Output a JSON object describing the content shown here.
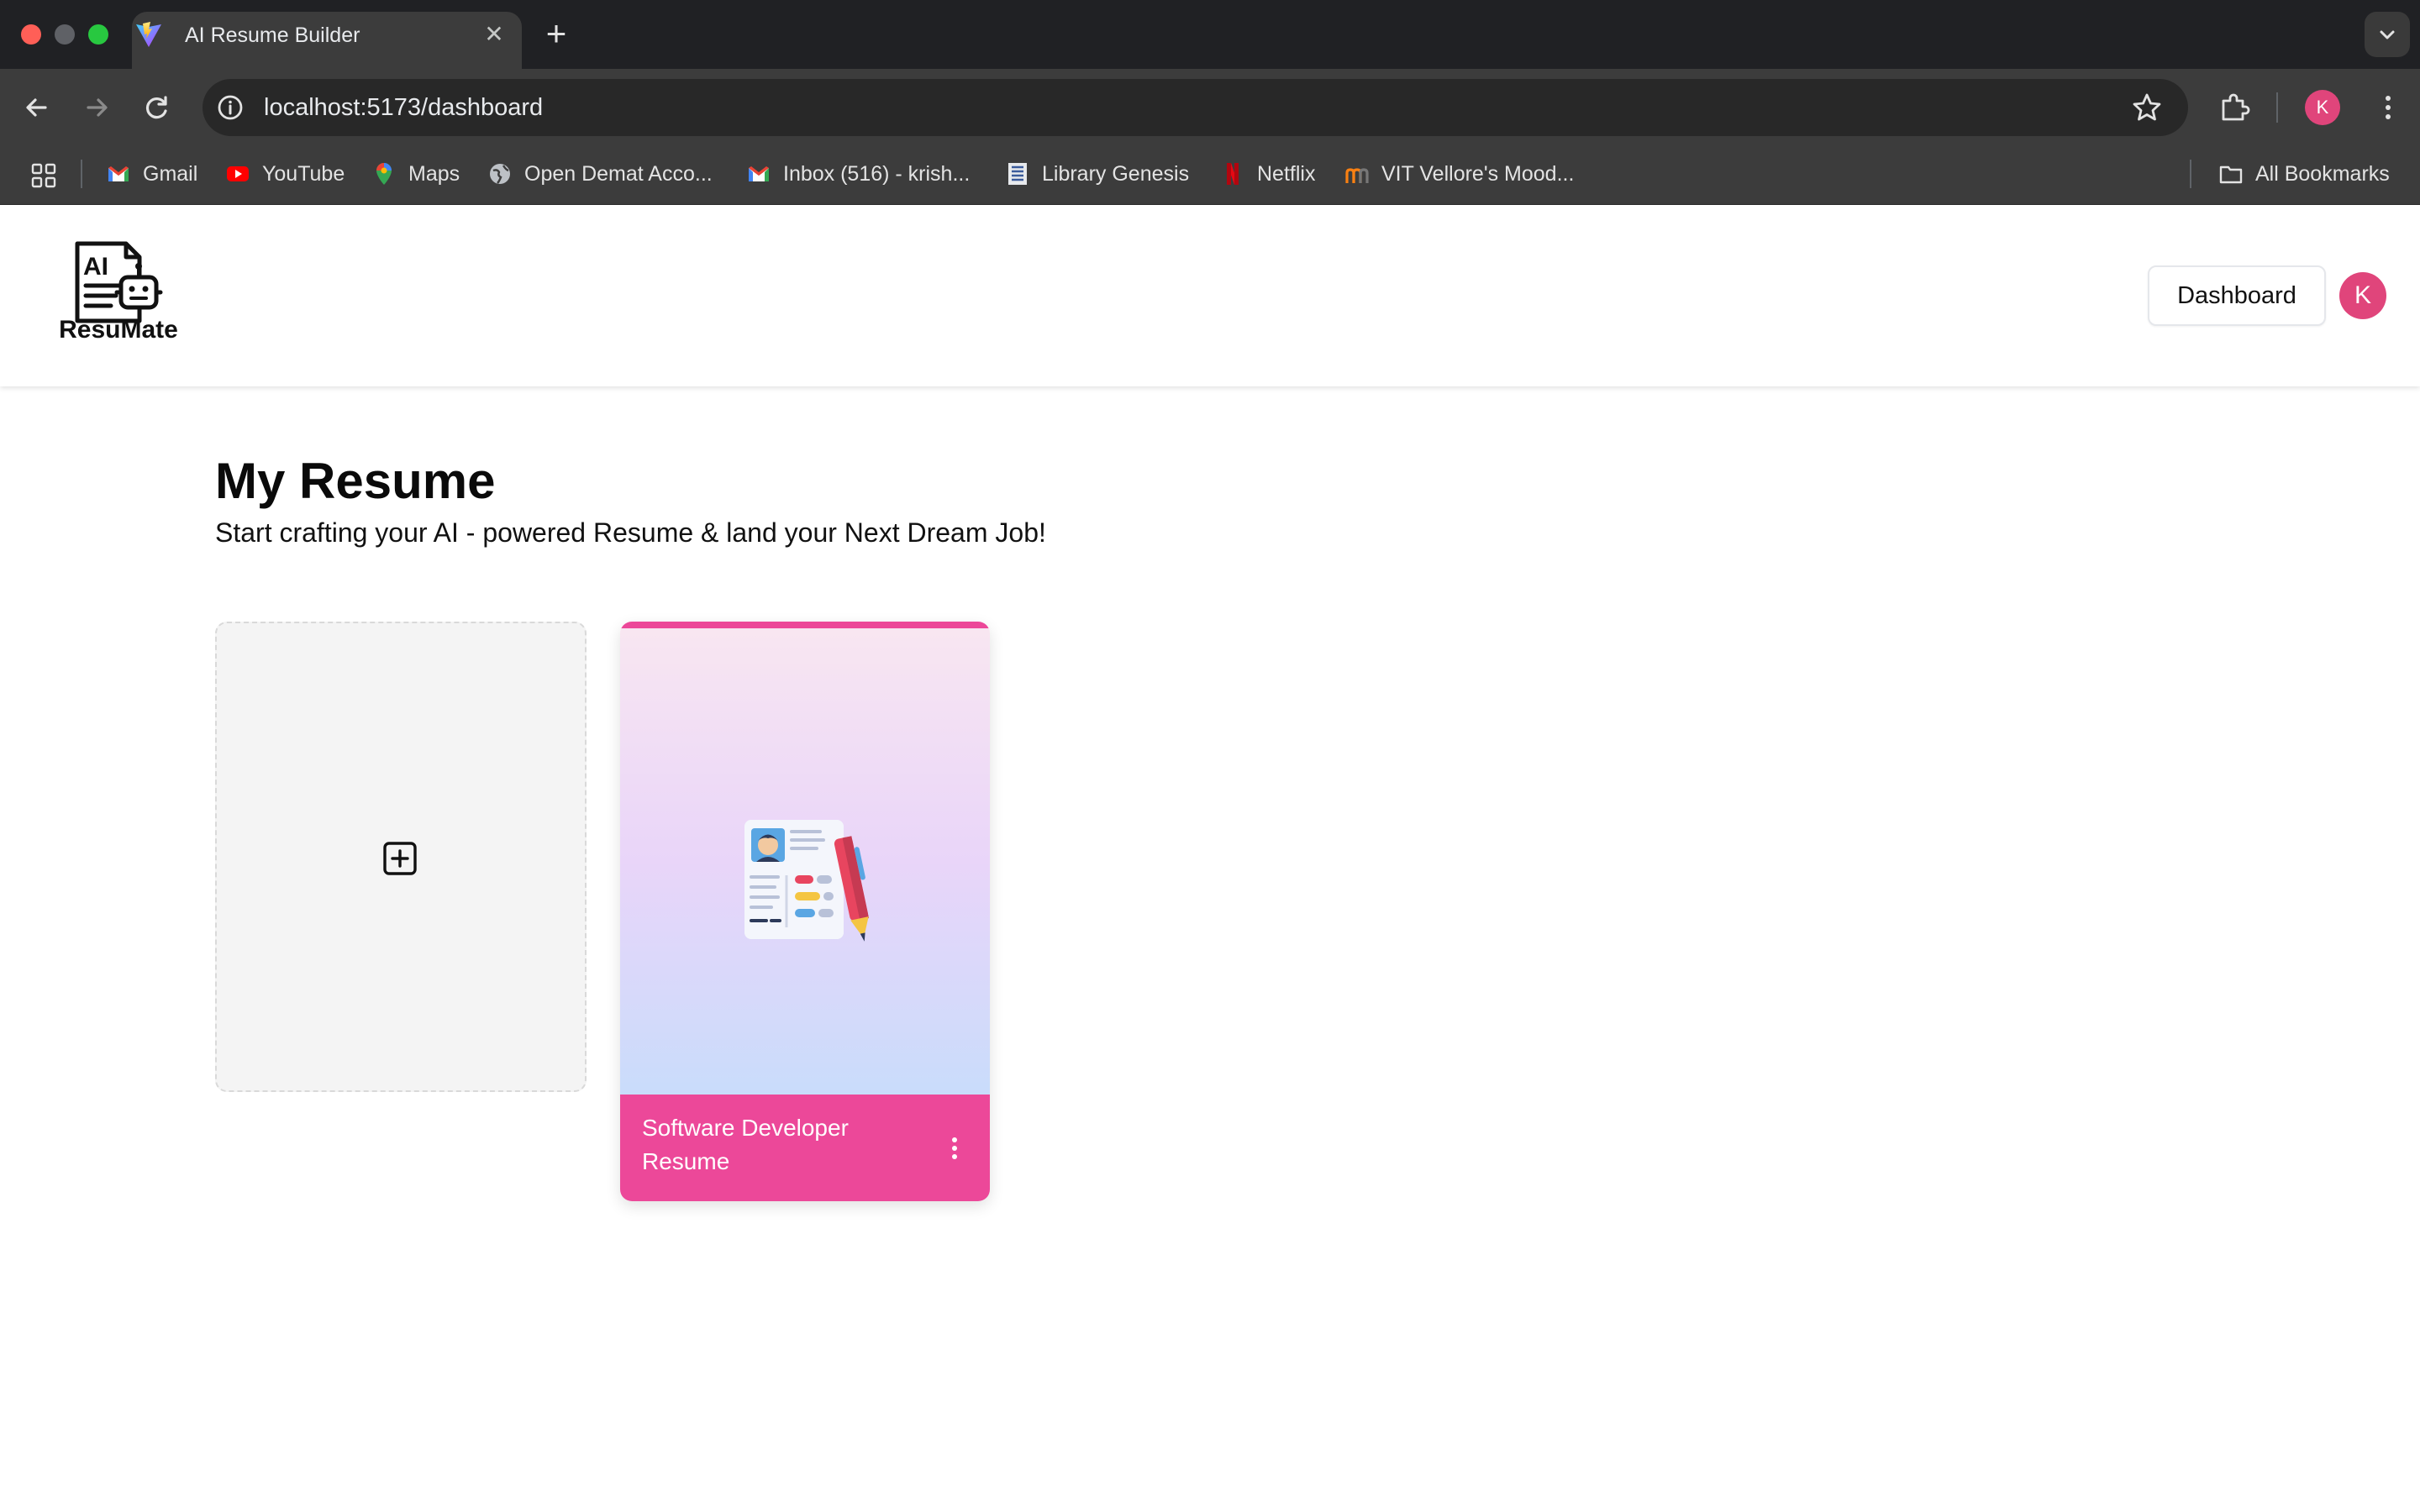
{
  "browser": {
    "tab_title": "AI Resume Builder",
    "url": "localhost:5173/dashboard",
    "profile_initial": "K",
    "bookmarks": [
      {
        "label": "Gmail",
        "icon": "gmail-icon"
      },
      {
        "label": "YouTube",
        "icon": "youtube-icon"
      },
      {
        "label": "Maps",
        "icon": "maps-icon"
      },
      {
        "label": "Open Demat Acco...",
        "icon": "globe-icon"
      },
      {
        "label": "Inbox (516) - krish...",
        "icon": "gmail-icon"
      },
      {
        "label": "Library Genesis",
        "icon": "library-icon"
      },
      {
        "label": "Netflix",
        "icon": "netflix-icon"
      },
      {
        "label": "VIT Vellore's Mood...",
        "icon": "moodle-icon"
      }
    ],
    "all_bookmarks_label": "All Bookmarks"
  },
  "header": {
    "logo_text": "ResuMate",
    "logo_ai": "AI",
    "dashboard_label": "Dashboard",
    "avatar_initial": "K"
  },
  "main": {
    "title": "My Resume",
    "subtitle": "Start crafting your AI - powered Resume & land your Next Dream Job!",
    "resumes": [
      {
        "name": "Software Developer Resume"
      }
    ]
  },
  "colors": {
    "accent": "#ec4899",
    "avatar": "#e0457b"
  }
}
